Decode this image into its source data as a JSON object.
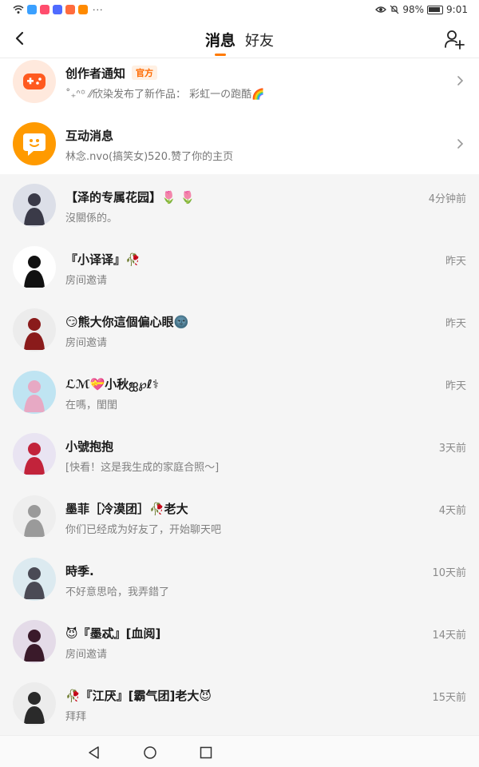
{
  "status_bar": {
    "battery": "98%",
    "time": "9:01",
    "app_icon_colors": [
      "#3aa0ff",
      "#ff4d6d",
      "#4f6bff",
      "#ff6b3d",
      "#ff8a00"
    ]
  },
  "nav": {
    "tabs": [
      {
        "label": "消息",
        "active": true
      },
      {
        "label": "好友",
        "active": false
      }
    ],
    "accent_color": "#ff7a00"
  },
  "system_rows": [
    {
      "title": "创作者通知",
      "badge": "官方",
      "subtitle": "˚₊ᐢ꙳ ⁄⁄欣染发布了新作品： 彩虹一の跑酷🌈",
      "icon": "gamepad-icon",
      "bg_color": "#ffe9dd"
    },
    {
      "title": "互动消息",
      "subtitle": "林念.nvo(搞笑女)520.赞了你的主页",
      "icon": "chat-smile-icon",
      "bg_color": "#ff9a00"
    }
  ],
  "conversations": [
    {
      "name": "【泽的专属花园】🌷 🌷",
      "message": "沒關係的。",
      "time": "4分钟前",
      "avatar_color": "#dcdfe8",
      "avatar_figure": "#3a3a48"
    },
    {
      "name": "『小译译』🥀",
      "message": "房间邀请",
      "time": "昨天",
      "avatar_color": "#ffffff",
      "avatar_figure": "#111111"
    },
    {
      "name": "😏熊大你這個偏心眼🌚",
      "message": "房间邀请",
      "time": "昨天",
      "avatar_color": "#ececec",
      "avatar_figure": "#8a1b1b"
    },
    {
      "name": "ℒℳ💝小秋ஐ℘ℓ⚕",
      "message": "在嗎，閨閨",
      "time": "昨天",
      "avatar_color": "#bfe4f2",
      "avatar_figure": "#e7a9c4"
    },
    {
      "name": "小號抱抱",
      "message": "[快看！这是我生成的家庭合照～]",
      "time": "3天前",
      "avatar_color": "#e9e4f2",
      "avatar_figure": "#c2233b"
    },
    {
      "name": "墨菲［冷漠团］🥀老大",
      "message": "你们已经成为好友了，开始聊天吧",
      "time": "4天前",
      "avatar_color": "#eeeeee",
      "avatar_figure": "#9a9a9a"
    },
    {
      "name": "時季.",
      "message": "不好意思哈，我弄錯了",
      "time": "10天前",
      "avatar_color": "#dceaf0",
      "avatar_figure": "#4a4a55"
    },
    {
      "name": "😈『墨忒』[血阅]",
      "message": "房间邀请",
      "time": "14天前",
      "avatar_color": "#e4dbe8",
      "avatar_figure": "#3a1a2a"
    },
    {
      "name": "🥀『江厌』[霸气团]老大😈",
      "message": "拜拜",
      "time": "15天前",
      "avatar_color": "#ececec",
      "avatar_figure": "#2a2a2a"
    }
  ]
}
